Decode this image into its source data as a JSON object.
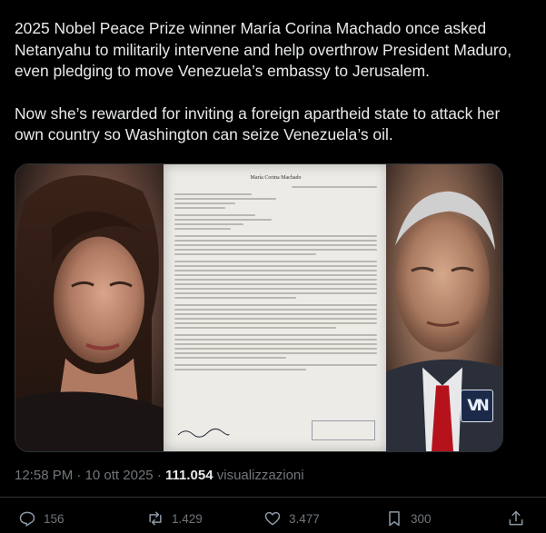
{
  "post": {
    "paragraph_1": "2025 Nobel Peace Prize winner María Corina Machado once asked Netanyahu to militarily intervene and help overthrow President Maduro, even pledging to move Venezuela’s embassy to Jerusalem.",
    "paragraph_2": "Now she’s rewarded for inviting a foreign apartheid state to attack her own country so Washington can seize Venezuela’s oil."
  },
  "media": {
    "document_heading": "María Corina Machado",
    "badge_text": "VN"
  },
  "meta": {
    "time": "12:58 PM",
    "separator": "·",
    "date": "10 ott 2025",
    "views_count": "111.054",
    "views_label": "visualizzazioni"
  },
  "actions": {
    "replies": "156",
    "reposts": "1.429",
    "likes": "3.477",
    "bookmarks": "300"
  },
  "icons": {
    "reply": "reply-icon",
    "repost": "repost-icon",
    "like": "heart-icon",
    "bookmark": "bookmark-icon",
    "share": "share-icon"
  },
  "colors": {
    "background": "#000000",
    "text": "#e7e9ea",
    "muted": "#71767b",
    "border": "#2f3336"
  }
}
